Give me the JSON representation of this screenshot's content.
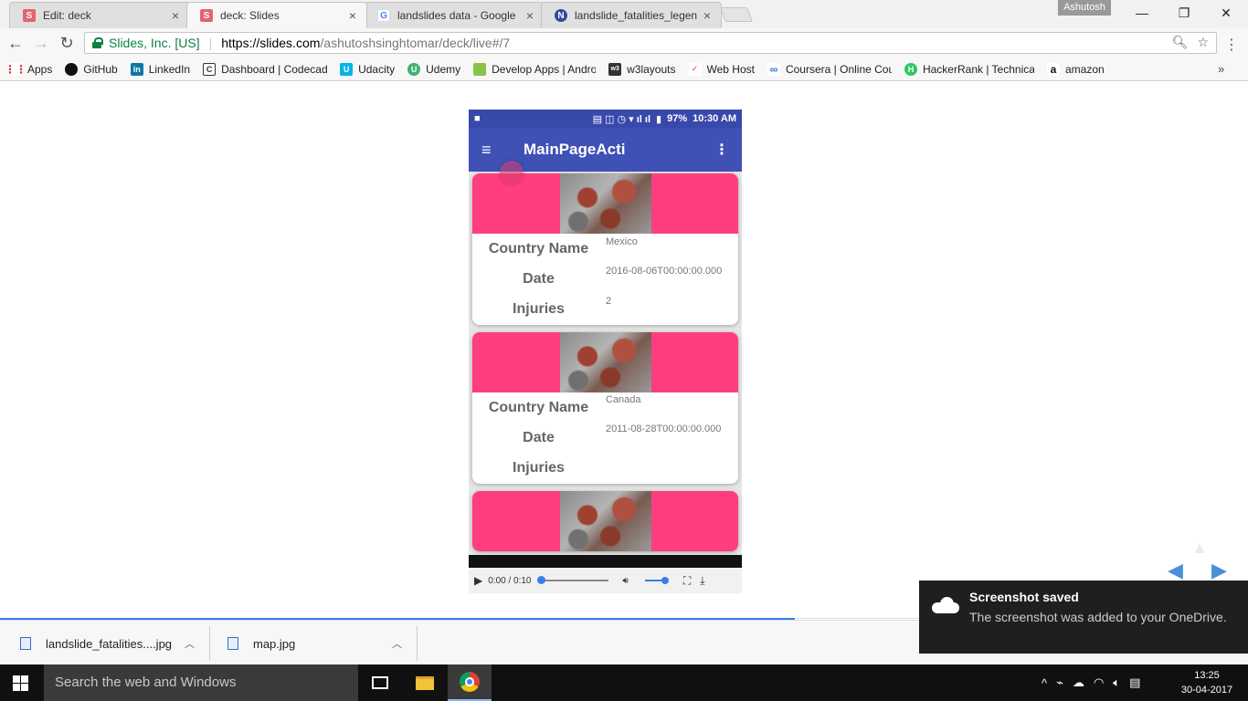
{
  "browser": {
    "tabs": [
      {
        "title": "Edit: deck",
        "favicon": "S",
        "favicon_color": "#e3656e"
      },
      {
        "title": "deck: Slides",
        "favicon": "S",
        "favicon_color": "#e3656e"
      },
      {
        "title": "landslides data - Google",
        "favicon": "G",
        "favicon_color": "#4285f4"
      },
      {
        "title": "landslide_fatalities_legen",
        "favicon": "N",
        "favicon_color": "#2e4c9c"
      }
    ],
    "profile": "Ashutosh",
    "secure_label": "Slides, Inc. [US]",
    "url_scheme_host": "https://slides.com",
    "url_path": "/ashutoshsinghtomar/deck/live#/7",
    "bookmarks": [
      {
        "label": "Apps",
        "icon": "apps-grid-icon",
        "color": "#555"
      },
      {
        "label": "GitHub",
        "icon": "github-icon",
        "color": "#111"
      },
      {
        "label": "LinkedIn",
        "icon": "linkedin-icon",
        "color": "#0e76a8"
      },
      {
        "label": "Dashboard | Codecad",
        "icon": "codecademy-icon",
        "color": "#444"
      },
      {
        "label": "Udacity",
        "icon": "udacity-icon",
        "color": "#02b3e4"
      },
      {
        "label": "Udemy",
        "icon": "udemy-icon",
        "color": "#3cb371"
      },
      {
        "label": "Develop Apps | Andro",
        "icon": "android-icon",
        "color": "#8bc34a"
      },
      {
        "label": "w3layouts",
        "icon": "w3-icon",
        "color": "#333"
      },
      {
        "label": "Web Host",
        "icon": "webhost-icon",
        "color": "#e53935"
      },
      {
        "label": "Coursera | Online Cou",
        "icon": "coursera-icon",
        "color": "#2a73cc"
      },
      {
        "label": "HackerRank | Technica",
        "icon": "hackerrank-icon",
        "color": "#2ec866"
      },
      {
        "label": "amazon",
        "icon": "amazon-icon",
        "color": "#111"
      }
    ]
  },
  "phone": {
    "status_time": "10:30 AM",
    "battery": "97%",
    "app_title": "MainPageActi",
    "cards": [
      {
        "labels": [
          "Country Name",
          "Date",
          "Injuries"
        ],
        "country": "Mexico",
        "date": "2016-08-06T00:00:00.000",
        "injuries": "2"
      },
      {
        "labels": [
          "Country Name",
          "Date",
          "Injuries"
        ],
        "country": "Canada",
        "date": "2011-08-28T00:00:00.000",
        "injuries": ""
      }
    ],
    "video_time": "0:00 / 0:10"
  },
  "downloads": [
    {
      "name": "landslide_fatalities....jpg"
    },
    {
      "name": "map.jpg"
    }
  ],
  "toast": {
    "title": "Screenshot saved",
    "body": "The screenshot was added to your OneDrive."
  },
  "taskbar": {
    "search_placeholder": "Search the web and Windows",
    "time": "13:25",
    "date": "30-04-2017"
  },
  "colors": {
    "appbar": "#3f51b5",
    "card_header": "#ff3d7f",
    "accent": "#3b7de8"
  }
}
